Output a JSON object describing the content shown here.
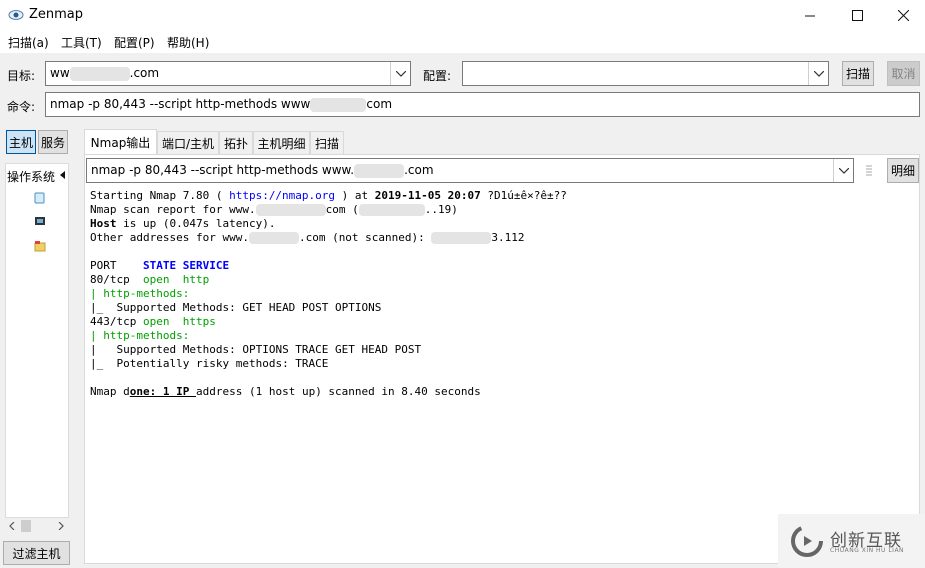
{
  "window": {
    "title": "Zenmap",
    "controls": {
      "minimize": "—",
      "maximize": "☐",
      "close": "✕"
    }
  },
  "menu": [
    "扫描(a)",
    "工具(T)",
    "配置(P)",
    "帮助(H)"
  ],
  "target": {
    "label": "目标:",
    "value_prefix": "ww",
    "value_suffix": ".com"
  },
  "profile": {
    "label": "配置:",
    "value": ""
  },
  "buttons": {
    "scan": "扫描",
    "cancel": "取消",
    "details": "明细",
    "filter_hosts": "过滤主机"
  },
  "command": {
    "label": "命令:",
    "value_prefix": "nmap -p 80,443 --script http-methods www",
    "value_suffix": "com"
  },
  "left_tabs": {
    "hosts": "主机",
    "services": "服务"
  },
  "os_header": "操作系统",
  "result_tabs": [
    "Nmap输出",
    "端口/主机",
    "拓扑",
    "主机明细",
    "扫描"
  ],
  "output_command": {
    "prefix": "nmap -p 80,443 --script http-methods www.",
    "suffix": ".com"
  },
  "output": {
    "l1_a": "Starting Nmap 7.80 ( ",
    "l1_url": "https://nmap.org",
    "l1_b": " ) at ",
    "l1_date": "2019-11-05 20:07",
    "l1_c": " ?D1ú±ê×?ê±??",
    "l2_a": "Nmap scan report for www.",
    "l2_b": "com (",
    "l2_c": "..19)",
    "l3_a": "Host",
    "l3_b": " is up (0.047s latency).",
    "l4_a": "Other addresses for www.",
    "l4_b": ".com (not scanned): ",
    "l4_c": "3.112",
    "hdr_port": "PORT",
    "hdr_state": "STATE",
    "hdr_service": "SERVICE",
    "p1_port": "80/tcp",
    "p1_state": "open",
    "p1_service": "http",
    "p1_script": "http-methods:",
    "p1_methods": "Supported Methods: GET HEAD POST OPTIONS",
    "p2_port": "443/tcp",
    "p2_state": "open",
    "p2_service": "https",
    "p2_script": "http-methods:",
    "p2_methods": "Supported Methods: OPTIONS TRACE GET HEAD POST",
    "p2_risky": "Potentially risky methods: TRACE",
    "done_a": "Nmap d",
    "done_b": "one: 1 IP ",
    "done_c": "address (1 host up) scanned in 8.40 seconds"
  },
  "watermark": {
    "text": "创新互联",
    "sub": "CHUANG XIN HU LIAN"
  },
  "colors": {
    "keyword": "#0000ff",
    "open": "#00a000",
    "active_tab_border": "#005499"
  }
}
